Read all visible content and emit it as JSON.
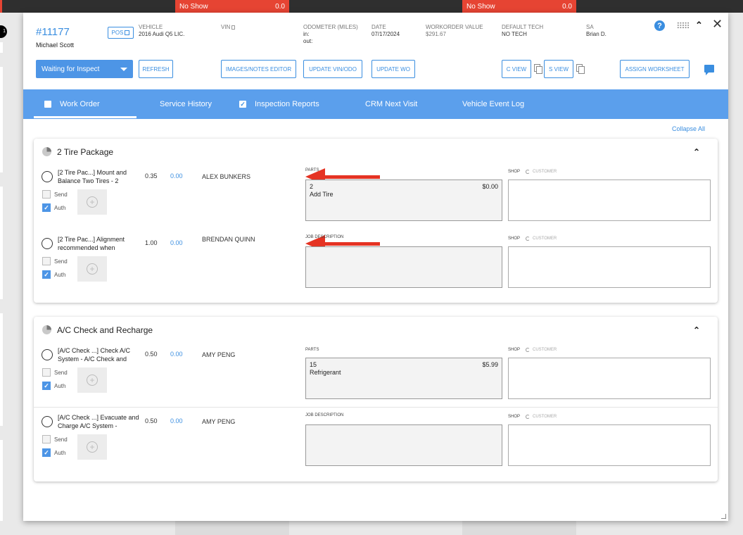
{
  "background": {
    "chips": [
      {
        "label": "No Show",
        "value": "0.0"
      },
      {
        "label": "No Show",
        "value": "0.0"
      }
    ],
    "side_badge": "1"
  },
  "header": {
    "wo_number": "#11177",
    "customer_name": "Michael Scott",
    "pos_label": "POS",
    "vehicle_label": "VEHICLE",
    "vehicle_value": "2016 Audi Q5 LIC.",
    "vin_label": "VIN",
    "odometer_label": "ODOMETER (MILES)",
    "odometer_in": "in:",
    "odometer_out": "out:",
    "date_label": "DATE",
    "date_value": "07/17/2024",
    "wo_value_label": "WORKORDER VALUE",
    "wo_value": "$291.67",
    "default_tech_label": "DEFAULT TECH",
    "default_tech_value": "NO TECH",
    "sa_label": "SA",
    "sa_value": "Brian D.",
    "help_glyph": "?"
  },
  "toolbar": {
    "status": "Waiting for Inspect",
    "refresh": "REFRESH",
    "images_notes": "IMAGES/NOTES EDITOR",
    "update_vin": "UPDATE VIN/ODO",
    "update_wo": "UPDATE WO",
    "c_view": "C VIEW",
    "s_view": "S VIEW",
    "assign_worksheet": "ASSIGN WORKSHEET"
  },
  "tabs": [
    {
      "label": "Work Order",
      "checkbox": true,
      "checked": false
    },
    {
      "label": "Service History"
    },
    {
      "label": "Inspection Reports",
      "checkbox": true,
      "checked": true
    },
    {
      "label": "CRM Next Visit"
    },
    {
      "label": "Vehicle Event Log"
    }
  ],
  "collapse_all": "Collapse All",
  "common": {
    "send": "Send",
    "auth": "Auth",
    "parts": "PARTS",
    "job_description": "JOB DESCRIPTION",
    "shop": "SHOP",
    "customer": "CUSTOMER",
    "check_glyph": "✓",
    "plus_glyph": "+"
  },
  "packages": [
    {
      "title": "2 Tire Package",
      "services": [
        {
          "name": "[2 Tire Pac...] Mount and Balance Two Tires - 2",
          "hours": "0.35",
          "amount": "0.00",
          "tech": "ALEX BUNKERS",
          "section": "parts",
          "part_qty": "2",
          "part_name": "Add Tire",
          "part_price": "$0.00",
          "send": false,
          "auth": true,
          "arrow": true
        },
        {
          "name": "[2 Tire Pac...] Alignment recommended when",
          "hours": "1.00",
          "amount": "0.00",
          "tech": "BRENDAN QUINN",
          "section": "job",
          "send": false,
          "auth": true,
          "arrow": true
        }
      ]
    },
    {
      "title": "A/C Check and Recharge",
      "services": [
        {
          "name": "[A/C Check ...] Check A/C System - A/C Check and",
          "hours": "0.50",
          "amount": "0.00",
          "tech": "AMY PENG",
          "section": "parts",
          "part_qty": "15",
          "part_name": "Refrigerant",
          "part_price": "$5.99",
          "send": false,
          "auth": true,
          "arrow": false
        },
        {
          "name": "[A/C Check ...] Evacuate and Charge A/C System -",
          "hours": "0.50",
          "amount": "0.00",
          "tech": "AMY PENG",
          "section": "job",
          "send": false,
          "auth": true,
          "arrow": false
        }
      ]
    }
  ],
  "colors": {
    "accent": "#3a8ee0",
    "tab_bar": "#5b9fec",
    "annotation_arrow": "#e53323",
    "no_show_chip": "#e64433"
  }
}
